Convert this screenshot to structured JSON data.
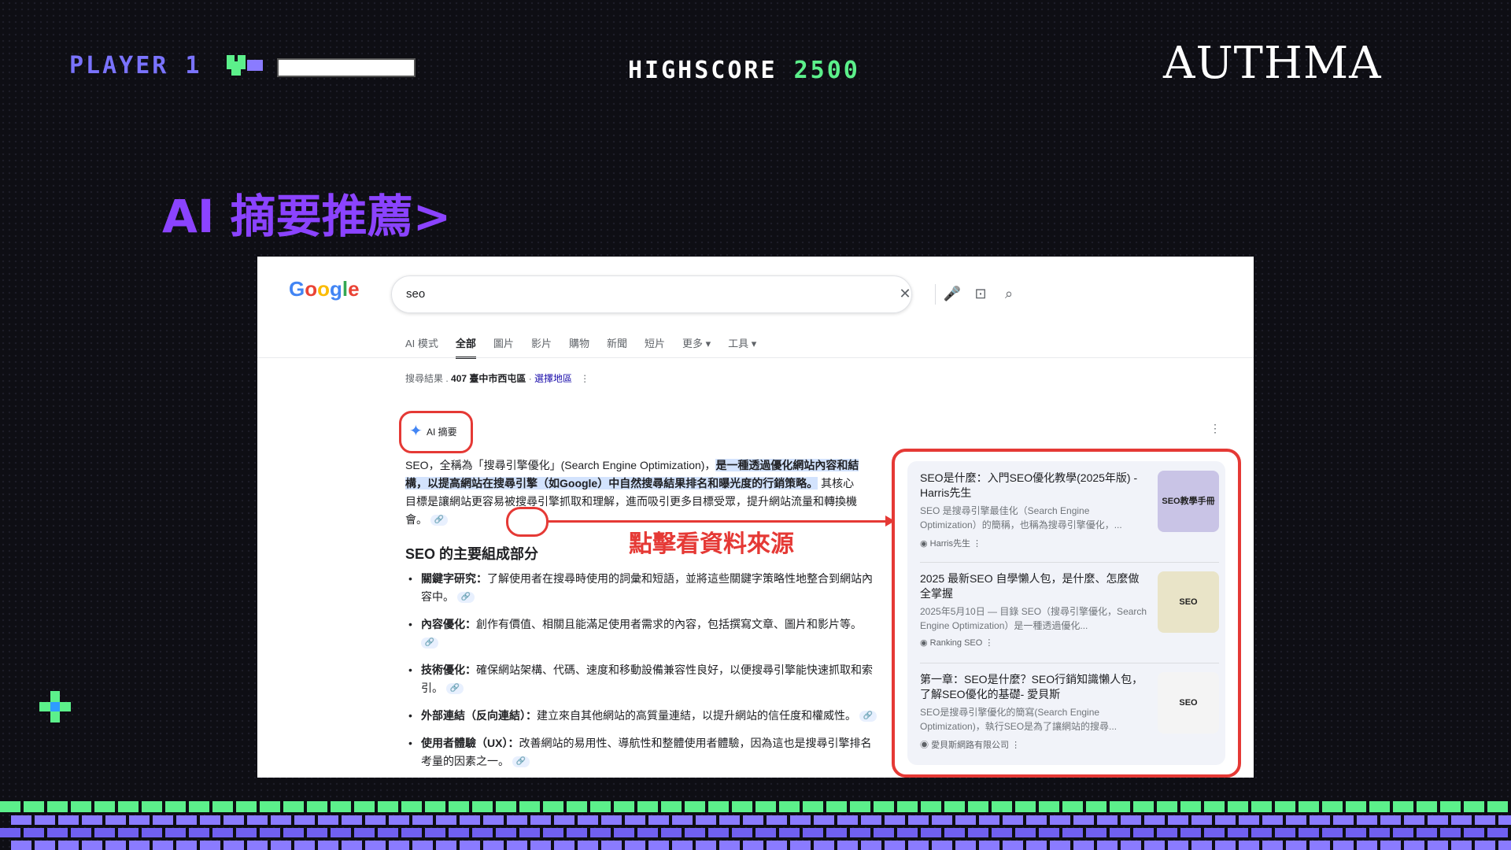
{
  "hud": {
    "player": "PLAYER 1",
    "highscore_label": "HIGHSCORE",
    "highscore_value": "2500",
    "logo": "AUTHMA"
  },
  "slide_title": "AI 摘要推薦>",
  "google": {
    "logo": "Google",
    "query": "seo",
    "tabs": [
      "AI 模式",
      "全部",
      "圖片",
      "影片",
      "購物",
      "新聞",
      "短片",
      "更多 ▾",
      "工具 ▾"
    ],
    "active_tab": "全部",
    "location_prefix": "搜尋結果 .",
    "location": "407 臺中市西屯區",
    "location_link": "選擇地區",
    "ai_label": "AI 摘要",
    "summary_plain": "SEO，全稱為「搜尋引擎優化」(Search Engine Optimization)，",
    "summary_highlight": "是一種透過優化網站內容和結構，以提高網站在搜尋引擎（如Google）中自然搜尋結果排名和曝光度的行銷策略。",
    "summary_tail": "其核心目標是讓網站更容易被搜尋引擎抓取和理解，進而吸引更多目標受眾，提升網站流量和轉換機會。",
    "callout": "點擊看資料來源",
    "section_title": "SEO 的主要組成部分",
    "bullets": [
      {
        "term": "關鍵字研究：",
        "text": "了解使用者在搜尋時使用的詞彙和短語，並將這些關鍵字策略性地整合到網站內容中。"
      },
      {
        "term": "內容優化：",
        "text": "創作有價值、相關且能滿足使用者需求的內容，包括撰寫文章、圖片和影片等。"
      },
      {
        "term": "技術優化：",
        "text": "確保網站架構、代碼、速度和移動設備兼容性良好，以便搜尋引擎能快速抓取和索引。"
      },
      {
        "term": "外部連結（反向連結）：",
        "text": "建立來自其他網站的高質量連結，以提升網站的信任度和權威性。"
      },
      {
        "term": "使用者體驗（UX）：",
        "text": "改善網站的易用性、導航性和整體使用者體驗，因為這也是搜尋引擎排名考量的因素之一。"
      }
    ],
    "sources": [
      {
        "title": "SEO是什麼：入門SEO優化教學(2025年版) - Harris先生",
        "snippet": "SEO 是搜尋引擎最佳化（Search Engine Optimization）的簡稱，也稱為搜尋引擎優化，...",
        "site": "Harris先生",
        "thumb": "SEO教學手冊"
      },
      {
        "title": "2025 最新SEO 自學懶人包，是什麼、怎麼做全掌握",
        "snippet": "2025年5月10日 — 目錄 SEO（搜尋引擎優化，Search Engine Optimization）是一種透過優化...",
        "site": "Ranking SEO",
        "thumb": "SEO"
      },
      {
        "title": "第一章：SEO是什麼？SEO行銷知識懶人包，了解SEO優化的基礎- 愛貝斯",
        "snippet": "SEO是搜尋引擎優化的簡寫(Search Engine Optimization)，執行SEO是為了讓網站的搜尋...",
        "site": "愛貝斯網路有限公司",
        "thumb": "SEO"
      }
    ]
  }
}
